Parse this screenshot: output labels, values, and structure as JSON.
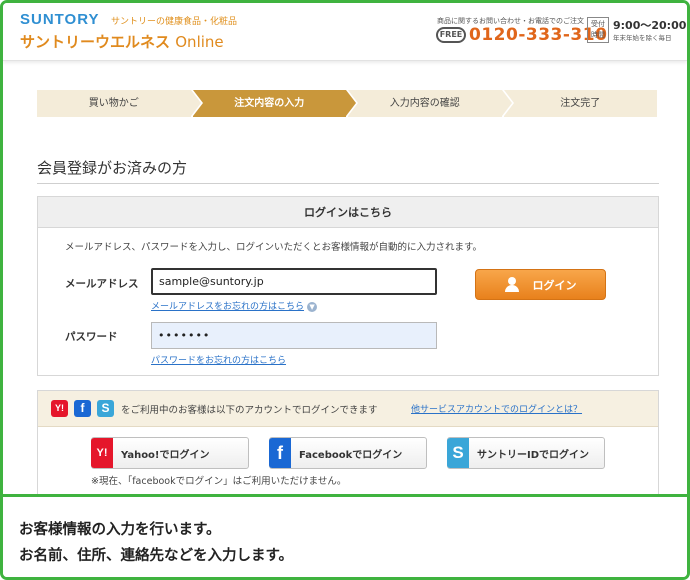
{
  "header": {
    "brand": "SUNTORY",
    "tagline": "サントリーの健康食品・化粧品",
    "shop_name": "サントリーウエルネス",
    "shop_suffix": "Online",
    "contact_note": "商品に関するお問い合わせ・お電話でのご注文",
    "phone_icon_label": "FREE",
    "phone": "0120-333-310",
    "hours_label_1": "受付",
    "hours_label_2": "時間",
    "hours": "9:00～20:00",
    "hours_note": "年末年始を除く毎日"
  },
  "steps": [
    {
      "label": "買い物かご",
      "active": false
    },
    {
      "label": "注文内容の入力",
      "active": true
    },
    {
      "label": "入力内容の確認",
      "active": false
    },
    {
      "label": "注文完了",
      "active": false
    }
  ],
  "section_title": "会員登録がお済みの方",
  "login": {
    "heading": "ログインはこちら",
    "description": "メールアドレス、パスワードを入力し、ログインいただくとお客様情報が自動的に入力されます。",
    "email_label": "メールアドレス",
    "email_value": "sample@suntory.jp",
    "email_forgot": "メールアドレスをお忘れの方はこちら",
    "password_label": "パスワード",
    "password_value": "•••••••",
    "password_forgot": "パスワードをお忘れの方はこちら",
    "button_label": "ログイン"
  },
  "social": {
    "icons": [
      "Y!",
      "f",
      "S"
    ],
    "text": "をご利用中のお客様は以下のアカウントでログインできます",
    "help_link": "他サービスアカウントでのログインとは？",
    "buttons": [
      {
        "icon": "Y!",
        "label": "Yahoo!でログイン"
      },
      {
        "icon": "f",
        "label": "Facebookでログイン"
      },
      {
        "icon": "S",
        "label": "サントリーIDでログイン"
      }
    ],
    "note": "※現在、「facebookでログイン」はご利用いただけません。"
  },
  "caption": {
    "line1": "お客様情報の入力を行います。",
    "line2": "お名前、住所、連絡先などを入力します。"
  },
  "colors": {
    "frame": "#3fb33f",
    "brand_blue": "#2f8fd2",
    "brand_orange": "#e08a1e",
    "step_active": "#c9973b",
    "login_button": "#f39b3a",
    "link": "#2a72c8"
  }
}
